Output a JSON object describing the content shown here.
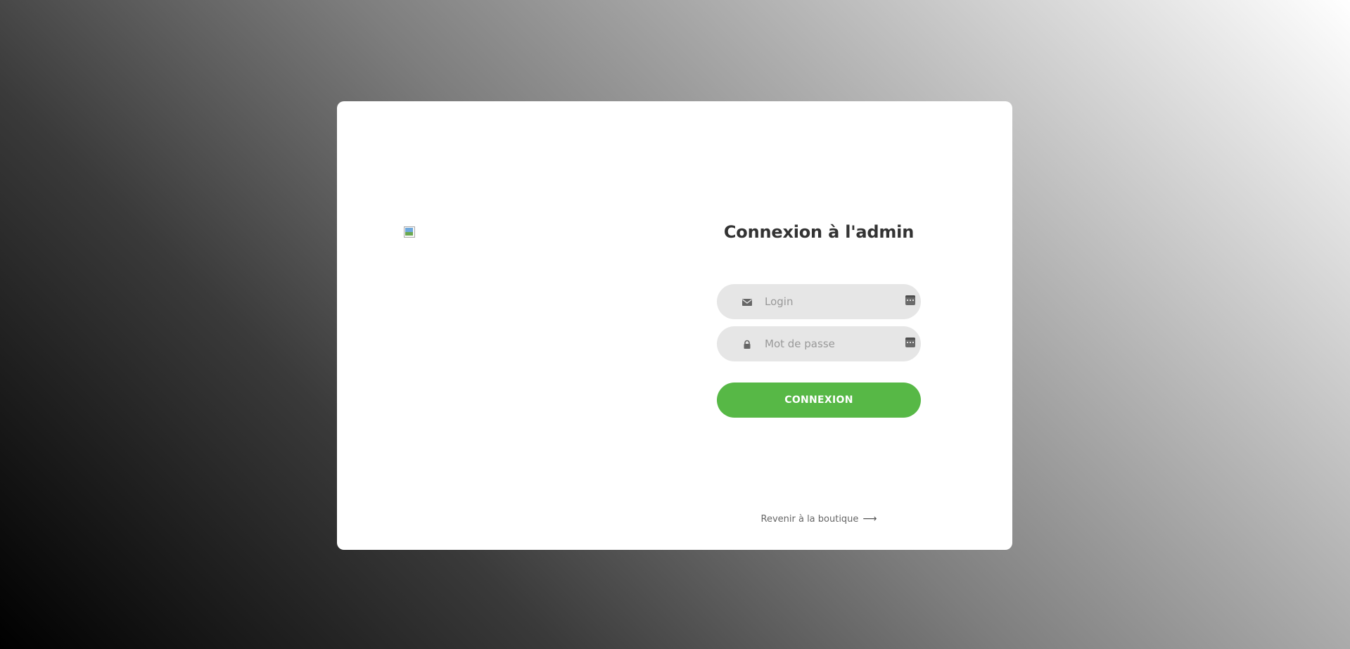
{
  "login_page": {
    "title": "Connexion à l'admin",
    "login_field": {
      "placeholder": "Login",
      "value": "",
      "icon": "envelope-icon"
    },
    "password_field": {
      "placeholder": "Mot de passe",
      "value": "",
      "icon": "lock-icon"
    },
    "password_manager_icon": "password-manager-icon",
    "submit_label": "CONNEXION",
    "back_link_label": "Revenir à la boutique",
    "back_link_icon": "arrow-right-icon",
    "logo_icon": "broken-image-icon"
  },
  "colors": {
    "accent": "#57b846",
    "field_bg": "#e6e6e6",
    "title": "#333333",
    "card_bg": "#ffffff"
  }
}
